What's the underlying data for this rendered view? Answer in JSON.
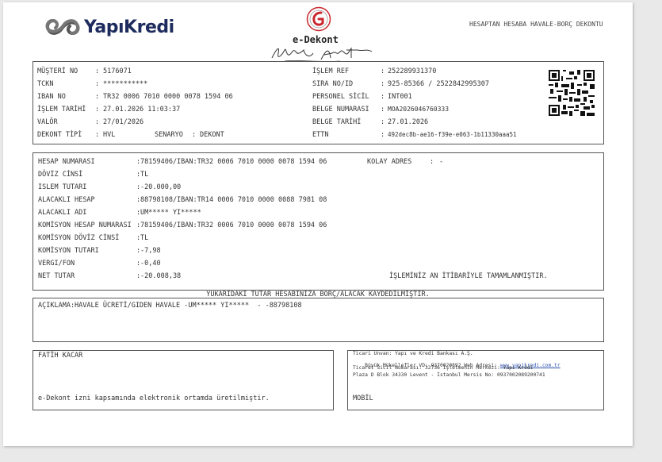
{
  "header": {
    "brand": "YapıKredi",
    "title": "e-Dekont",
    "doc_type": "HESAPTAN HESABA HAVALE-BORÇ DEKONTU"
  },
  "customer": {
    "left": [
      {
        "label": "MÜŞTERİ NO",
        "value": "5176071"
      },
      {
        "label": "TCKN",
        "value": "***********"
      },
      {
        "label": "IBAN NO",
        "value": "TR32 0006 7010 0000 0078 1594 06"
      },
      {
        "label": "İŞLEM TARİHİ",
        "value": "27.01.2026 11:03:37"
      },
      {
        "label": "VALÖR",
        "value": "27/01/2026"
      },
      {
        "label": "DEKONT TİPİ",
        "value": "HVL",
        "extra_label": "SENARYO",
        "extra_value": "DEKONT"
      }
    ],
    "right": [
      {
        "label": "İŞLEM REF",
        "value": "252289931370"
      },
      {
        "label": "SIRA NO/ID",
        "value": "925-85366 / 2522842995307"
      },
      {
        "label": "PERSONEL SİCİL",
        "value": "INT001"
      },
      {
        "label": "BELGE NUMARASI",
        "value": "MOA2026046760333"
      },
      {
        "label": "BELGE TARİHİ",
        "value": "27.01.2026"
      },
      {
        "label": "ETTN",
        "value": "492dec8b-ae16-f39e-e063-1b11330aaa51"
      }
    ]
  },
  "transaction": {
    "rows": [
      {
        "label": "HESAP NUMARASI",
        "value": "78159406/IBAN:TR32 0006 7010 0000 0078 1594 06"
      },
      {
        "label": "DÖVİZ CİNSİ",
        "value": "TL"
      },
      {
        "label": "ISLEM TUTARI",
        "value": "-20.000,00"
      },
      {
        "label": "ALACAKLI HESAP",
        "value": "88798108/IBAN:TR14 0006 7010 0000 0088 7981 08"
      },
      {
        "label": "ALACAKLI ADI",
        "value": "UM***** YI*****"
      },
      {
        "label": "KOMİSYON HESAP NUMARASI",
        "value": "78159406/IBAN:TR32 0006 7010 0000 0078 1594 06"
      },
      {
        "label": "KOMİSYON DÖVİZ CİNSİ",
        "value": "TL"
      },
      {
        "label": "KOMİSYON TUTARI",
        "value": "-7,98"
      },
      {
        "label": "VERGI/FON",
        "value": "-0,40"
      },
      {
        "label": "NET TUTAR",
        "value": "-20.008,38"
      }
    ],
    "kolay_adres_label": "KOLAY ADRES",
    "kolay_adres_value": "-",
    "completed_note": "İŞLEMİNİZ AN İTİBARİYLE TAMAMLANMIŞTIR."
  },
  "notice": "YUKARIDAKİ TUTAR HESABINIZA BORÇ/ALACAK KAYDEDİLMİŞTİR.",
  "description": "AÇIKLAMA:HAVALE ÜCRETİ/GIDEN HAVALE -UM***** YI*****  - -88798108",
  "footer": {
    "name": "FATİH KACAR",
    "electronic_note": "e-Dekont izni kapsamında elektronik ortamda üretilmiştir.",
    "company_lines": [
      "Ticari Unvan: Yapı ve Kredi Bankası A.Ş.",
      "Büyük Mükellefler VD: 9370020892 Web Adresi: ",
      "Ticaret Sicil Numarası: 32736 İşletmenin Merkezi: Yapı Kredi",
      "Plaza D Blok 34330 Levent - İstanbul Mersis No: 0937002089200741"
    ],
    "web": "www.yapikredi.com.tr",
    "channel": "MOBİL"
  }
}
